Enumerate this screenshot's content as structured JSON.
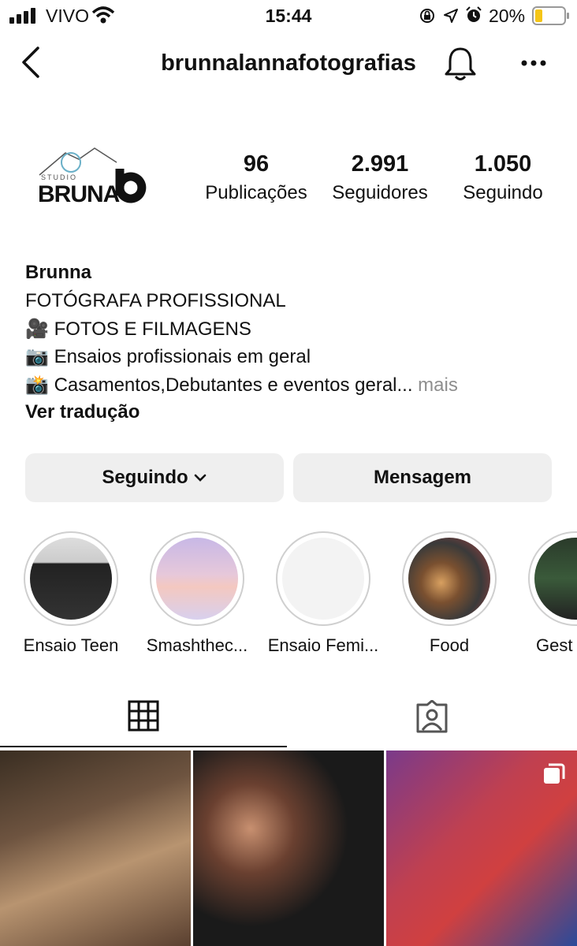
{
  "status_bar": {
    "carrier": "VIVO",
    "time": "15:44",
    "battery": "20%"
  },
  "header": {
    "username": "brunnalannafotografias"
  },
  "profile": {
    "logo_small": "STUDIO",
    "logo_main": "BRUNA",
    "logo_mark": "b",
    "stats": [
      {
        "value": "96",
        "label": "Publicações"
      },
      {
        "value": "2.991",
        "label": "Seguidores"
      },
      {
        "value": "1.050",
        "label": "Seguindo"
      }
    ]
  },
  "bio": {
    "name": "Brunna",
    "lines": [
      {
        "emoji": "",
        "text": "FOTÓGRAFA PROFISSIONAL"
      },
      {
        "emoji": "🎥",
        "text": "FOTOS E FILMAGENS"
      },
      {
        "emoji": "📷",
        "text": "Ensaios profissionais em geral"
      },
      {
        "emoji": "📸",
        "text": "Casamentos,Debutantes e eventos geral..."
      }
    ],
    "more": "mais",
    "translate": "Ver tradução"
  },
  "actions": {
    "following": "Seguindo",
    "message": "Mensagem"
  },
  "highlights": [
    {
      "label": "Ensaio Teen"
    },
    {
      "label": "Smashthec..."
    },
    {
      "label": "Ensaio Femi..."
    },
    {
      "label": "Food"
    },
    {
      "label": "Gest"
    }
  ],
  "icons": {
    "back": "back-arrow-icon",
    "bell": "bell-icon",
    "more": "more-options-icon",
    "grid": "grid-icon",
    "tagged": "tagged-icon"
  },
  "colors": {
    "button_bg": "#efefef",
    "battery": "#f5c518",
    "muted_text": "#8e8e8e"
  }
}
